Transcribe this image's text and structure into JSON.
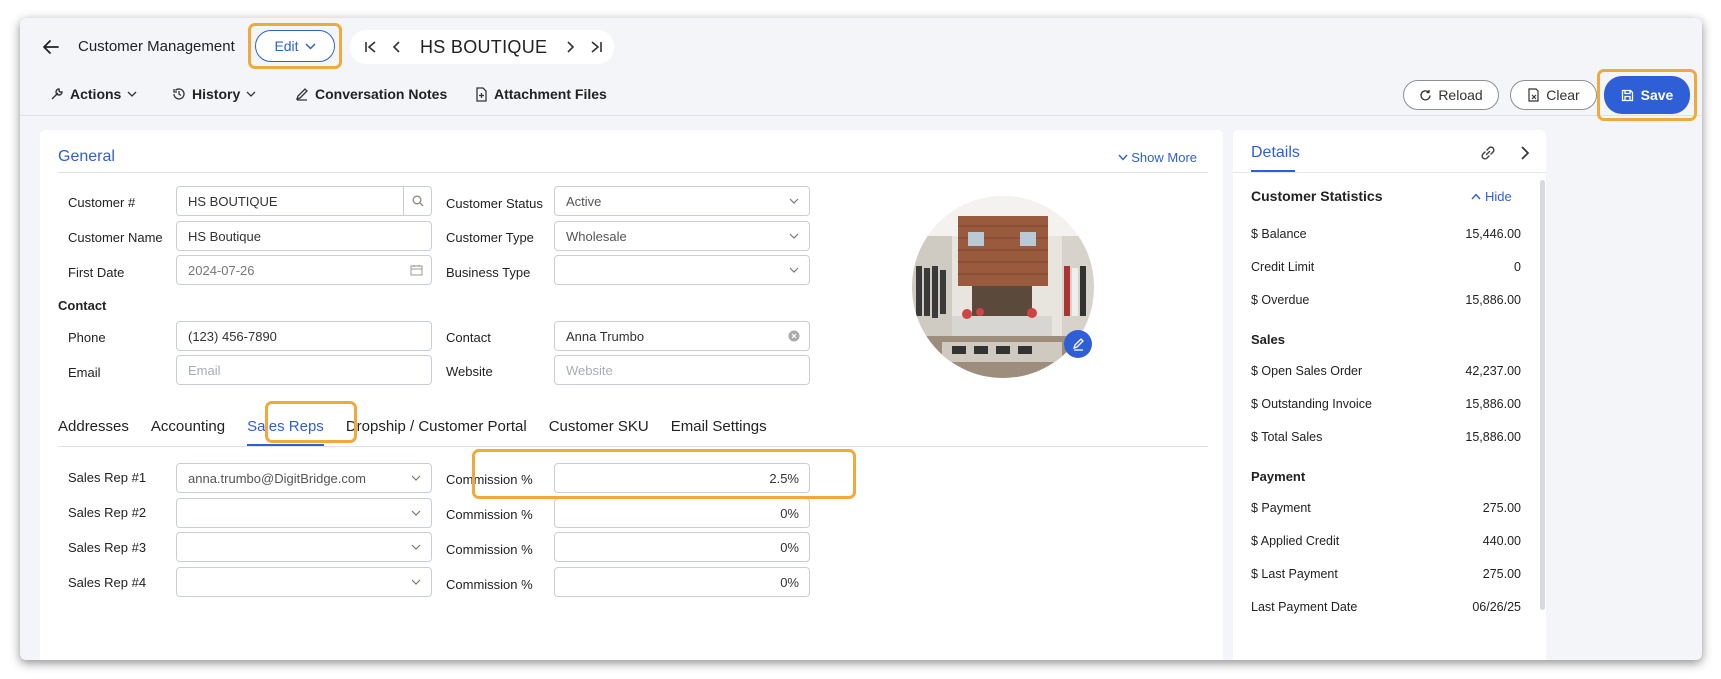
{
  "header": {
    "title": "Customer Management",
    "edit_label": "Edit",
    "customer_name": "HS BOUTIQUE"
  },
  "toolbar": {
    "actions": "Actions",
    "history": "History",
    "notes": "Conversation Notes",
    "attachments": "Attachment Files",
    "reload": "Reload",
    "clear": "Clear",
    "save": "Save"
  },
  "general": {
    "section_title": "General",
    "show_more": "Show More",
    "customer_number_label": "Customer #",
    "customer_number": "HS BOUTIQUE",
    "customer_name_label": "Customer Name",
    "customer_name": "HS Boutique",
    "first_date_label": "First Date",
    "first_date": "2024-07-26",
    "customer_status_label": "Customer Status",
    "customer_status": "Active",
    "customer_type_label": "Customer Type",
    "customer_type": "Wholesale",
    "business_type_label": "Business Type",
    "business_type": ""
  },
  "contact": {
    "section_title": "Contact",
    "phone_label": "Phone",
    "phone": "(123) 456-7890",
    "email_label": "Email",
    "email_placeholder": "Email",
    "contact_label": "Contact",
    "contact": "Anna Trumbo",
    "website_label": "Website",
    "website_placeholder": "Website"
  },
  "tabs": [
    "Addresses",
    "Accounting",
    "Sales Reps",
    "Dropship / Customer Portal",
    "Customer SKU",
    "Email Settings"
  ],
  "sales_reps": {
    "rows": [
      {
        "label": "Sales Rep #1",
        "value": "anna.trumbo@DigitBridge.com",
        "commission_label": "Commission %",
        "commission": "2.5%"
      },
      {
        "label": "Sales Rep #2",
        "value": "",
        "commission_label": "Commission %",
        "commission": "0%"
      },
      {
        "label": "Sales Rep #3",
        "value": "",
        "commission_label": "Commission %",
        "commission": "0%"
      },
      {
        "label": "Sales Rep #4",
        "value": "",
        "commission_label": "Commission %",
        "commission": "0%"
      }
    ]
  },
  "details": {
    "title": "Details",
    "stats_title": "Customer Statistics",
    "hide": "Hide",
    "stats": [
      {
        "label": "$ Balance",
        "value": "15,446.00"
      },
      {
        "label": "Credit Limit",
        "value": "0"
      },
      {
        "label": "$ Overdue",
        "value": "15,886.00"
      }
    ],
    "sales_title": "Sales",
    "sales": [
      {
        "label": "$ Open Sales Order",
        "value": "42,237.00"
      },
      {
        "label": "$ Outstanding Invoice",
        "value": "15,886.00"
      },
      {
        "label": "$ Total Sales",
        "value": "15,886.00"
      }
    ],
    "payment_title": "Payment",
    "payment": [
      {
        "label": "$ Payment",
        "value": "275.00"
      },
      {
        "label": "$ Applied Credit",
        "value": "440.00"
      },
      {
        "label": "$ Last Payment",
        "value": "275.00"
      },
      {
        "label": "Last Payment Date",
        "value": "06/26/25"
      }
    ]
  },
  "colors": {
    "accent": "#2f5fd6",
    "highlight": "#f0a93c"
  }
}
